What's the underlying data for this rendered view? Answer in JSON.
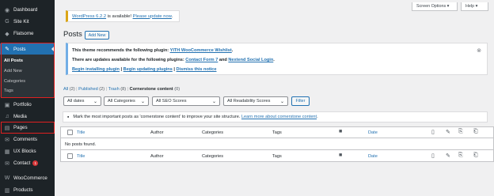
{
  "sidebar": {
    "items": [
      {
        "label": "Dashboard",
        "icon": "dashboard-icon",
        "glyph": "◉"
      },
      {
        "label": "Site Kit",
        "icon": "sitekit-icon",
        "glyph": "G"
      },
      {
        "label": "Flatsome",
        "icon": "flatsome-icon",
        "glyph": "◆"
      },
      {
        "label": "Posts",
        "icon": "pin-icon",
        "glyph": "✎"
      },
      {
        "label": "Portfolio",
        "icon": "portfolio-icon",
        "glyph": "▣"
      },
      {
        "label": "Media",
        "icon": "media-icon",
        "glyph": "♫"
      },
      {
        "label": "Pages",
        "icon": "pages-icon",
        "glyph": "▤"
      },
      {
        "label": "Comments",
        "icon": "comments-icon",
        "glyph": "✉"
      },
      {
        "label": "UX Blocks",
        "icon": "uxblocks-icon",
        "glyph": "▦"
      },
      {
        "label": "Contact",
        "icon": "contact-icon",
        "glyph": "✉",
        "badge": "1"
      },
      {
        "label": "WooCommerce",
        "icon": "woocommerce-icon",
        "glyph": "W"
      },
      {
        "label": "Products",
        "icon": "products-icon",
        "glyph": "▥"
      }
    ],
    "posts_submenu": [
      "All Posts",
      "Add New",
      "Categories",
      "Tags"
    ]
  },
  "screen_options": {
    "screen_options_label": "Screen Options ▾",
    "help_label": "Help ▾"
  },
  "update_notice": {
    "prefix": "WordPress 6.2.2",
    "middle": " is available! ",
    "link": "Please update now",
    "suffix": "."
  },
  "page": {
    "title": "Posts",
    "add_new": "Add New"
  },
  "plugin_notice": {
    "line1_text": "This theme recommends the following plugin: ",
    "line1_link": "YITH WooCommerce Wishlist",
    "line1_end": ".",
    "line2_text": "There are updates available for the following plugins: ",
    "line2_link1": "Contact Form 7",
    "line2_and": " and ",
    "line2_link2": "Nextend Social Login",
    "line2_end": ".",
    "line3_link1": "Begin installing plugin",
    "line3_sep1": " | ",
    "line3_link2": "Begin updating plugins",
    "line3_sep2": " | ",
    "line3_link3": "Dismiss this notice",
    "dismiss_glyph": "⊗"
  },
  "views": {
    "all": "All",
    "all_count": " (2)",
    "sep1": " | ",
    "published": "Published",
    "published_count": " (2)",
    "sep2": " | ",
    "trash": "Trash",
    "trash_count": " (8)",
    "sep3": " | ",
    "cornerstone": "Cornerstone content",
    "cornerstone_count": " (0)"
  },
  "filters": {
    "dates": "All dates",
    "categories": "All Categories",
    "seo": "All SEO Scores",
    "readability": "All Readability Scores",
    "filter_button": "Filter"
  },
  "hint": {
    "text": "Mark the most important posts as 'cornerstone content' to improve your site structure. ",
    "link": "Learn more about cornerstone content",
    "end": "."
  },
  "table": {
    "columns": {
      "title": "Title",
      "author": "Author",
      "categories": "Categories",
      "tags": "Tags",
      "date": "Date"
    },
    "empty_text": "No posts found."
  }
}
